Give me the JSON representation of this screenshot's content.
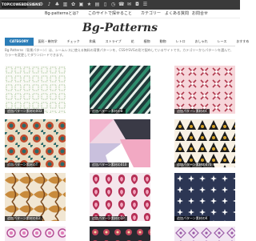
{
  "topbar": {
    "brand": "TOPICOWEBDESIGNS",
    "icons": [
      "home-icon",
      "gear-icon",
      "music-icon",
      "tree-icon",
      "chart-icon",
      "gear-icon",
      "image-icon",
      "star-icon",
      "book-icon",
      "document-icon",
      "clock-icon",
      "phone-icon",
      "mail-icon",
      "bag-icon",
      "menu-icon"
    ],
    "links": [
      "Bg-patternsとは？",
      "このサイトで探せること",
      "カテゴリー",
      "よくある質問",
      "お問合せ"
    ]
  },
  "subnav": [
    "Bg-patternsとは？",
    "このサイトで探せること",
    "カテゴリー",
    "よくある質問",
    "お問合せ"
  ],
  "logo": "Bg-Patterns",
  "categories": [
    "CATEGORY",
    "図形・幾何学",
    "チェック",
    "和風",
    "ストライプ",
    "花",
    "植物",
    "動物",
    "レトロ",
    "おしゃれ",
    "レース",
    "おすすめ"
  ],
  "description": "Bg-Patterns（背景パターン）は、シームレスに使える無料の背景パターンを、CSSやSVGの形で配布しているサイトです。カテゴリーからパターンを選んで、カラーを変更してダウンロードできます。",
  "tiles": [
    {
      "caption": "追加パターン素材の003"
    },
    {
      "caption": "追加パターン素材のB"
    },
    {
      "caption": "追加パターン素材のF"
    },
    {
      "caption": "追加パターン素材のT"
    },
    {
      "caption": "追加パターン素材の010"
    },
    {
      "caption": "追加パターン素材の070"
    },
    {
      "caption": "追加パターン素材の03"
    },
    {
      "caption": "追加パターン素材の1P"
    },
    {
      "caption": "追加パターン素材のK"
    },
    {
      "caption": ""
    },
    {
      "caption": ""
    },
    {
      "caption": ""
    }
  ],
  "colors": {
    "topbar": "#3a3a3a",
    "accent": "#2b7db8"
  }
}
